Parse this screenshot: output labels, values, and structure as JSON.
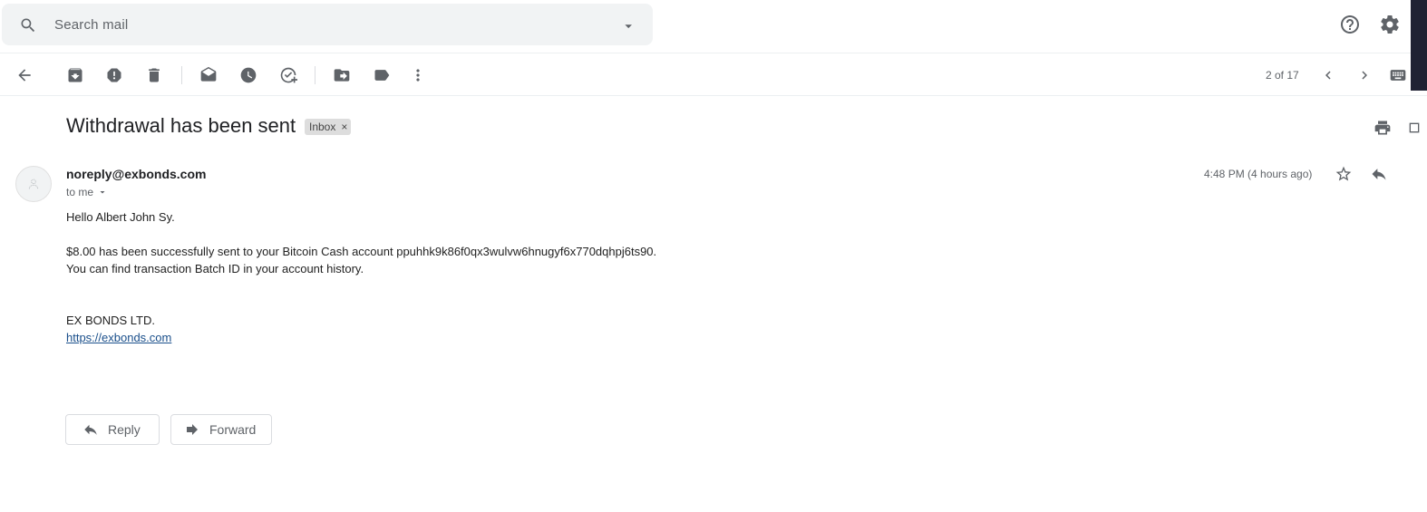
{
  "search": {
    "placeholder": "Search mail"
  },
  "toolbar": {
    "pager_text": "2 of 17"
  },
  "message": {
    "subject": "Withdrawal has been sent",
    "label": "Inbox",
    "sender": "noreply@exbonds.com",
    "recipient": "to me",
    "timestamp": "4:48 PM (4 hours ago)",
    "greeting": "Hello Albert John Sy.",
    "line1": "$8.00 has been successfully sent to your Bitcoin Cash account ppuhhk9k86f0qx3wulvw6hnugyf6x770dqhpj6ts90.",
    "line2": "You can find transaction Batch ID in your account history.",
    "signature": "EX BONDS LTD.",
    "link": "https://exbonds.com"
  },
  "actions": {
    "reply_label": "Reply",
    "forward_label": "Forward"
  },
  "colors": {
    "search_bg": "#f1f3f4",
    "link": "#1a4f8b",
    "icon": "#5f6368"
  }
}
